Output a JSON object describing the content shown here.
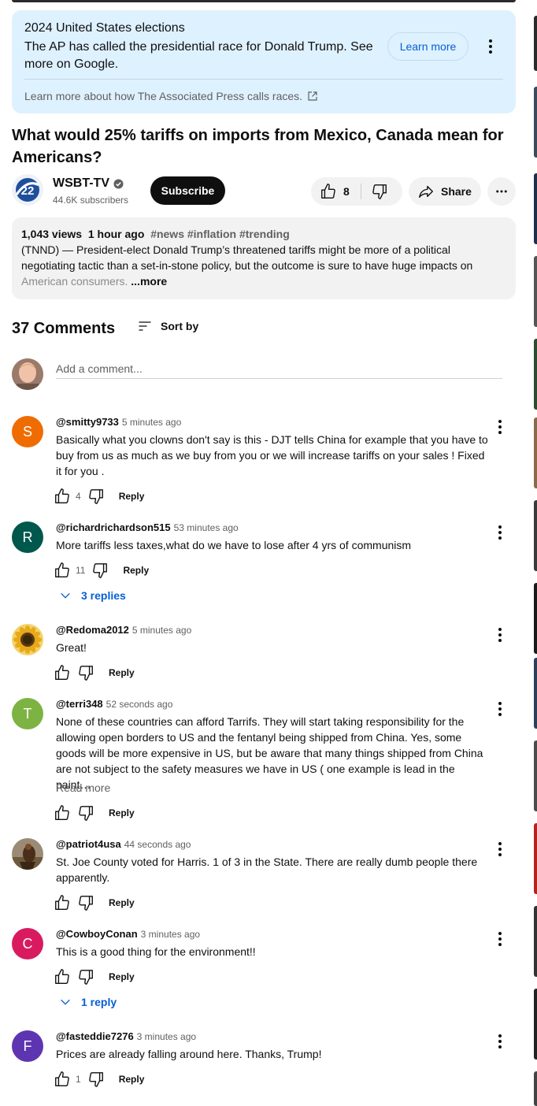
{
  "colors": {
    "accent_blue": "#065fd4",
    "card_bg": "#def1ff",
    "pill_bg": "#f2f2f2",
    "text_primary": "#0f0f0f",
    "text_secondary": "#606060"
  },
  "election_card": {
    "title": "2024 United States elections",
    "text": "The AP has called the presidential race for Donald Trump. See more on Google.",
    "learn_more": "Learn more",
    "ap_link": "Learn more about how The Associated Press calls races."
  },
  "video": {
    "title": "What would 25% tariffs on imports from Mexico, Canada mean for Americans?",
    "channel": {
      "name": "WSBT-TV",
      "subscribers": "44.6K subscribers",
      "subscribe_label": "Subscribe"
    },
    "likes": "8",
    "share_label": "Share",
    "description": {
      "views": "1,043 views",
      "age": "1 hour ago",
      "tags": "#news #inflation #trending",
      "text": "(TNND) — President-elect Donald Trump’s threatened tariffs might be more of a political negotiating tactic than a set-in-stone policy, but the outcome is sure to have huge impacts on",
      "text_faded": "American consumers.",
      "more_label": "...more"
    }
  },
  "comments_section": {
    "count_label": "37 Comments",
    "sort_label": "Sort by",
    "add_placeholder": "Add a comment..."
  },
  "comments": [
    {
      "author": "@smitty9733",
      "time": "5 minutes ago",
      "avatar_letter": "S",
      "avatar_color": "#ef6c00",
      "text": "Basically what you clowns don't say is this -  DJT tells China for example that you have to buy from us as much as we buy from you or we will increase tariffs on your sales ! Fixed it for you .",
      "likes": "4",
      "reply_label": "Reply"
    },
    {
      "author": "@richardrichardson515",
      "time": "53 minutes ago",
      "avatar_letter": "R",
      "avatar_color": "#00574b",
      "text": "More tariffs less taxes,what do we have to lose after 4 yrs of communism",
      "likes": "11",
      "reply_label": "Reply",
      "replies_label": "3 replies"
    },
    {
      "author": "@Redoma2012",
      "time": "5 minutes ago",
      "avatar_image": "sunflower",
      "text": "Great!",
      "likes": "",
      "reply_label": "Reply"
    },
    {
      "author": "@terri348",
      "time": "52 seconds ago",
      "avatar_letter": "T",
      "avatar_color": "#7cb342",
      "text": "None of these countries can afford Tarrifs. They will start taking responsibility for the allowing open borders to US and the fentanyl being shipped from China. Yes, some goods will be more expensive in US, but be aware that many things shipped from China are not subject to the safety measures we have in US ( one example is lead in the paint…",
      "read_more": "Read more",
      "likes": "",
      "reply_label": "Reply"
    },
    {
      "author": "@patriot4usa",
      "time": "44 seconds ago",
      "avatar_image": "photo",
      "text": "St. Joe County voted for Harris. 1 of 3 in the State. There are really dumb people there apparently.",
      "likes": "",
      "reply_label": "Reply"
    },
    {
      "author": "@CowboyConan",
      "time": "3 minutes ago",
      "avatar_letter": "C",
      "avatar_color": "#d81b60",
      "text": "This is a good thing for the environment!!",
      "likes": "",
      "reply_label": "Reply",
      "replies_label": "1 reply"
    },
    {
      "author": "@fasteddie7276",
      "time": "3 minutes ago",
      "avatar_letter": "F",
      "avatar_color": "#5e35b1",
      "text": "Prices are already falling around here.  Thanks, Trump!",
      "likes": "1",
      "reply_label": "Reply"
    }
  ]
}
